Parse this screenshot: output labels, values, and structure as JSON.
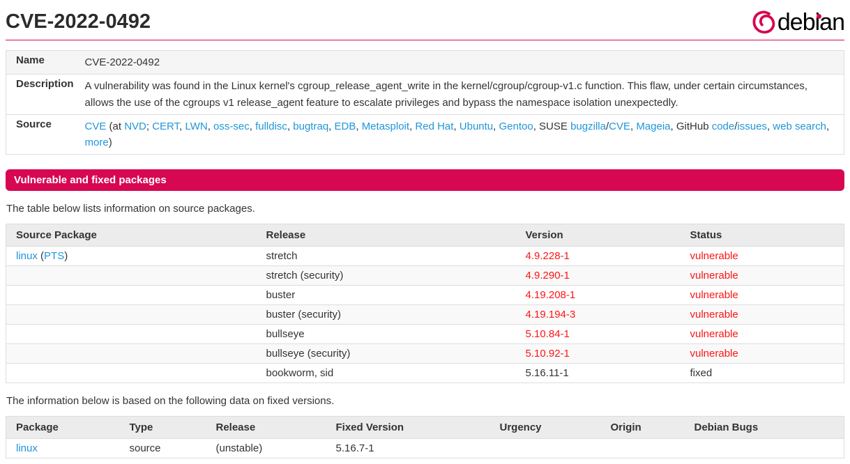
{
  "header": {
    "title": "CVE-2022-0492",
    "logo_text": "debian"
  },
  "colors": {
    "accent": "#d70751",
    "link": "#2196d9",
    "danger": "#fe1414"
  },
  "details": {
    "rows": [
      {
        "label": "Name",
        "value": "CVE-2022-0492"
      },
      {
        "label": "Description",
        "value": "A vulnerability was found in the Linux kernel's cgroup_release_agent_write in the kernel/cgroup/cgroup-v1.c function. This flaw, under certain circumstances, allows the use of the cgroups v1 release_agent feature to escalate privileges and bypass the namespace isolation unexpectedly."
      },
      {
        "label": "Source",
        "segments": [
          {
            "text": "CVE",
            "link": true
          },
          {
            "text": " (at ",
            "link": false
          },
          {
            "text": "NVD",
            "link": true
          },
          {
            "text": "; ",
            "link": false
          },
          {
            "text": "CERT",
            "link": true
          },
          {
            "text": ", ",
            "link": false
          },
          {
            "text": "LWN",
            "link": true
          },
          {
            "text": ", ",
            "link": false
          },
          {
            "text": "oss-sec",
            "link": true
          },
          {
            "text": ", ",
            "link": false
          },
          {
            "text": "fulldisc",
            "link": true
          },
          {
            "text": ", ",
            "link": false
          },
          {
            "text": "bugtraq",
            "link": true
          },
          {
            "text": ", ",
            "link": false
          },
          {
            "text": "EDB",
            "link": true
          },
          {
            "text": ", ",
            "link": false
          },
          {
            "text": "Metasploit",
            "link": true
          },
          {
            "text": ", ",
            "link": false
          },
          {
            "text": "Red Hat",
            "link": true
          },
          {
            "text": ", ",
            "link": false
          },
          {
            "text": "Ubuntu",
            "link": true
          },
          {
            "text": ", ",
            "link": false
          },
          {
            "text": "Gentoo",
            "link": true
          },
          {
            "text": ", SUSE ",
            "link": false
          },
          {
            "text": "bugzilla",
            "link": true
          },
          {
            "text": "/",
            "link": false
          },
          {
            "text": "CVE",
            "link": true
          },
          {
            "text": ", ",
            "link": false
          },
          {
            "text": "Mageia",
            "link": true
          },
          {
            "text": ", GitHub ",
            "link": false
          },
          {
            "text": "code",
            "link": true
          },
          {
            "text": "/",
            "link": false
          },
          {
            "text": "issues",
            "link": true
          },
          {
            "text": ", ",
            "link": false
          },
          {
            "text": "web search",
            "link": true
          },
          {
            "text": ", ",
            "link": false
          },
          {
            "text": "more",
            "link": true
          },
          {
            "text": ")",
            "link": false
          }
        ]
      }
    ]
  },
  "banner": {
    "title": "Vulnerable and fixed packages"
  },
  "paragraphs": {
    "source_intro": "The table below lists information on source packages.",
    "fixed_intro": "The information below is based on the following data on fixed versions."
  },
  "source_packages_table": {
    "headers": [
      "Source Package",
      "Release",
      "Version",
      "Status"
    ],
    "rows": [
      {
        "package": "linux",
        "package_extra": "PTS",
        "release": "stretch",
        "version": "4.9.228-1",
        "status": "vulnerable",
        "vulnerable": true
      },
      {
        "package": "",
        "package_extra": "",
        "release": "stretch (security)",
        "version": "4.9.290-1",
        "status": "vulnerable",
        "vulnerable": true
      },
      {
        "package": "",
        "package_extra": "",
        "release": "buster",
        "version": "4.19.208-1",
        "status": "vulnerable",
        "vulnerable": true
      },
      {
        "package": "",
        "package_extra": "",
        "release": "buster (security)",
        "version": "4.19.194-3",
        "status": "vulnerable",
        "vulnerable": true
      },
      {
        "package": "",
        "package_extra": "",
        "release": "bullseye",
        "version": "5.10.84-1",
        "status": "vulnerable",
        "vulnerable": true
      },
      {
        "package": "",
        "package_extra": "",
        "release": "bullseye (security)",
        "version": "5.10.92-1",
        "status": "vulnerable",
        "vulnerable": true
      },
      {
        "package": "",
        "package_extra": "",
        "release": "bookworm, sid",
        "version": "5.16.11-1",
        "status": "fixed",
        "vulnerable": false
      }
    ]
  },
  "fixed_versions_table": {
    "headers": [
      "Package",
      "Type",
      "Release",
      "Fixed Version",
      "Urgency",
      "Origin",
      "Debian Bugs"
    ],
    "rows": [
      {
        "package": "linux",
        "type": "source",
        "release": "(unstable)",
        "fixed_version": "5.16.7-1",
        "urgency": "",
        "origin": "",
        "debian_bugs": ""
      }
    ]
  }
}
